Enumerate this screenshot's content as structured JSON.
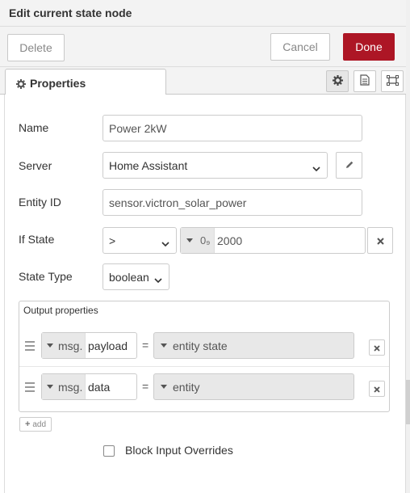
{
  "header": {
    "title": "Edit current state node"
  },
  "toolbar": {
    "delete_label": "Delete",
    "cancel_label": "Cancel",
    "done_label": "Done"
  },
  "tabs": [
    {
      "label": "Properties",
      "icon": "gear-icon"
    }
  ],
  "tab_icons": [
    "gear-icon",
    "document-icon",
    "frame-icon"
  ],
  "form": {
    "name": {
      "label": "Name",
      "value": "Power 2kW"
    },
    "server": {
      "label": "Server",
      "value": "Home Assistant"
    },
    "entity_id": {
      "label": "Entity ID",
      "value": "sensor.victron_solar_power"
    },
    "if_state": {
      "label": "If State",
      "operator": ">",
      "type_icon": "0₉",
      "value": "2000"
    },
    "state_type": {
      "label": "State Type",
      "value": "boolean"
    },
    "output": {
      "title": "Output properties",
      "rows": [
        {
          "prefix": "msg.",
          "property": "payload",
          "equals": "=",
          "value": "entity state"
        },
        {
          "prefix": "msg.",
          "property": "data",
          "equals": "=",
          "value": "entity"
        }
      ],
      "add_label": "add"
    },
    "block_overrides": {
      "label": "Block Input Overrides",
      "checked": false
    }
  },
  "colors": {
    "accent": "#ad1625",
    "header_bg": "#f3f3f3"
  }
}
